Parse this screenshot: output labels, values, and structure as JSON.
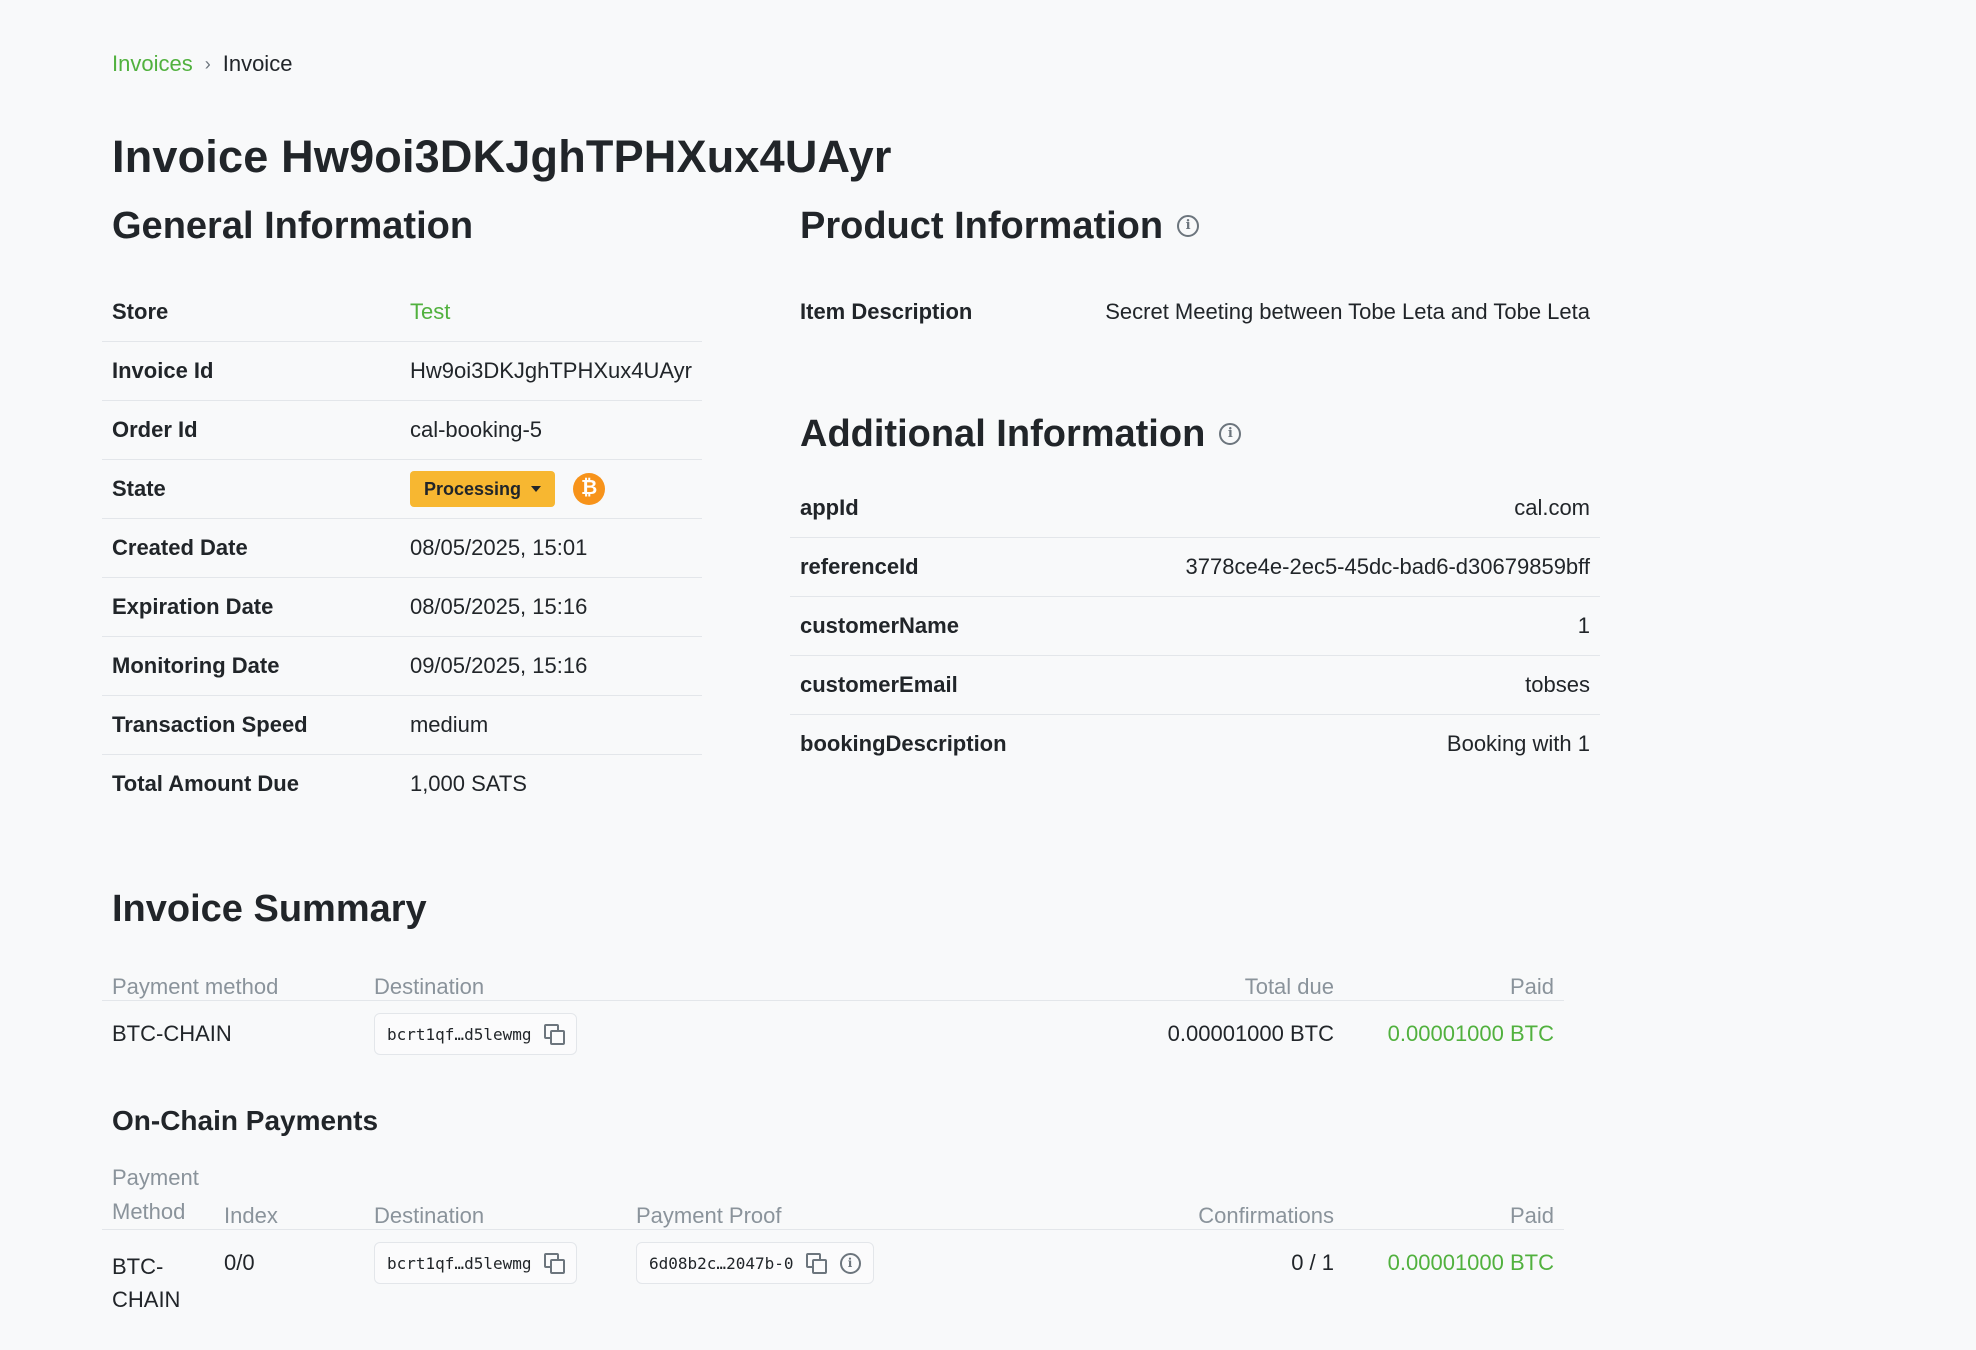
{
  "breadcrumb": {
    "parent": "Invoices",
    "current": "Invoice"
  },
  "page_title": "Invoice Hw9oi3DKJghTPHXux4UAyr",
  "general": {
    "title": "General Information",
    "rows": [
      {
        "label": "Store",
        "value": "Test"
      },
      {
        "label": "Invoice Id",
        "value": "Hw9oi3DKJghTPHXux4UAyr"
      },
      {
        "label": "Order Id",
        "value": "cal-booking-5"
      },
      {
        "label": "State",
        "value": "Processing"
      },
      {
        "label": "Created Date",
        "value": "08/05/2025, 15:01"
      },
      {
        "label": "Expiration Date",
        "value": "08/05/2025, 15:16"
      },
      {
        "label": "Monitoring Date",
        "value": "09/05/2025, 15:16"
      },
      {
        "label": "Transaction Speed",
        "value": "medium"
      },
      {
        "label": "Total Amount Due",
        "value": "1,000 SATS"
      }
    ],
    "bitcoin_icon": "₿"
  },
  "product": {
    "title": "Product Information",
    "rows": [
      {
        "label": "Item Description",
        "value": "Secret Meeting between Tobe Leta and Tobe Leta"
      }
    ]
  },
  "additional": {
    "title": "Additional Information",
    "rows": [
      {
        "label": "appId",
        "value": "cal.com"
      },
      {
        "label": "referenceId",
        "value": "3778ce4e-2ec5-45dc-bad6-d30679859bff"
      },
      {
        "label": "customerName",
        "value": "1"
      },
      {
        "label": "customerEmail",
        "value": "tobses"
      },
      {
        "label": "bookingDescription",
        "value": "Booking with 1"
      }
    ]
  },
  "summary": {
    "title": "Invoice Summary",
    "headers": {
      "method": "Payment method",
      "destination": "Destination",
      "total_due": "Total due",
      "paid": "Paid"
    },
    "row": {
      "method": "BTC-CHAIN",
      "destination": "bcrt1qf…d5lewmg",
      "total_due": "0.00001000 BTC",
      "paid": "0.00001000 BTC"
    }
  },
  "onchain": {
    "title": "On-Chain Payments",
    "headers": {
      "method_line1": "Payment",
      "method_line2": "Method",
      "index": "Index",
      "destination": "Destination",
      "proof": "Payment Proof",
      "confirmations": "Confirmations",
      "paid": "Paid"
    },
    "row": {
      "method_line1": "BTC-",
      "method_line2": "CHAIN",
      "index": "0/0",
      "destination": "bcrt1qf…d5lewmg",
      "proof": "6d08b2c…2047b-0",
      "confirmations": "0 / 1",
      "paid": "0.00001000 BTC"
    }
  },
  "colors": {
    "accent": "#51b13e",
    "badge": "#f7b731",
    "bitcoin": "#f7931a"
  }
}
